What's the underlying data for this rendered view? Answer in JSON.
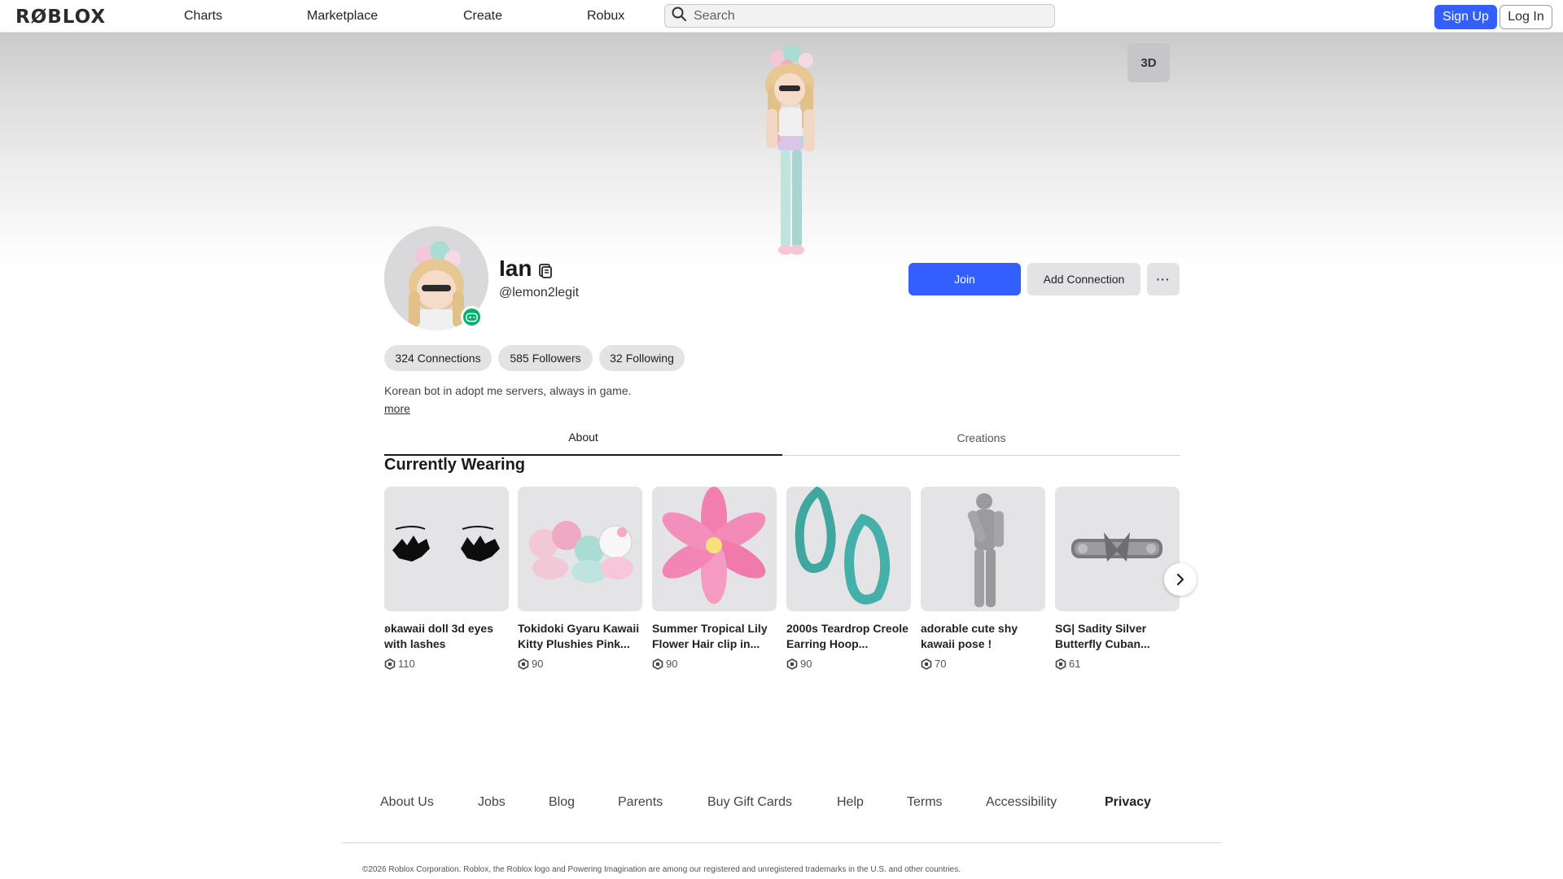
{
  "nav": {
    "logo": "RØBLOX",
    "links": [
      "Charts",
      "Marketplace",
      "Create",
      "Robux"
    ],
    "search_placeholder": "Search",
    "signup": "Sign Up",
    "login": "Log In"
  },
  "hero": {
    "view_3d": "3D"
  },
  "profile": {
    "display_name": "Ian",
    "username": "@lemon2legit",
    "join": "Join",
    "add_connection": "Add Connection",
    "more": "···",
    "stats": [
      {
        "count": "324",
        "label": "Connections"
      },
      {
        "count": "585",
        "label": "Followers"
      },
      {
        "count": "32",
        "label": "Following"
      }
    ],
    "bio": "Korean bot in adopt me servers, always in game.",
    "more_link": "more"
  },
  "tabs": [
    "About",
    "Creations"
  ],
  "wearing": {
    "title": "Currently Wearing",
    "items": [
      {
        "name": "ʚkawaii doll 3d eyes with lashes",
        "price": "110"
      },
      {
        "name": "Tokidoki Gyaru Kawaii Kitty Plushies Pink...",
        "price": "90"
      },
      {
        "name": "Summer Tropical Lily Flower Hair clip in...",
        "price": "90"
      },
      {
        "name": "2000s Teardrop Creole Earring Hoop...",
        "price": "90"
      },
      {
        "name": "adorable cute shy kawaii pose !",
        "price": "70"
      },
      {
        "name": "SG| Sadity Silver Butterfly Cuban...",
        "price": "61"
      }
    ]
  },
  "footer": {
    "links": [
      "About Us",
      "Jobs",
      "Blog",
      "Parents",
      "Buy Gift Cards",
      "Help",
      "Terms",
      "Accessibility",
      "Privacy"
    ],
    "copyright": "©2026 Roblox Corporation. Roblox, the Roblox logo and Powering Imagination are among our registered and unregistered trademarks in the U.S. and other countries."
  },
  "colors": {
    "primary_blue": "#335fff",
    "online_green": "#00b06f",
    "pill_gray": "#e3e3e5"
  }
}
